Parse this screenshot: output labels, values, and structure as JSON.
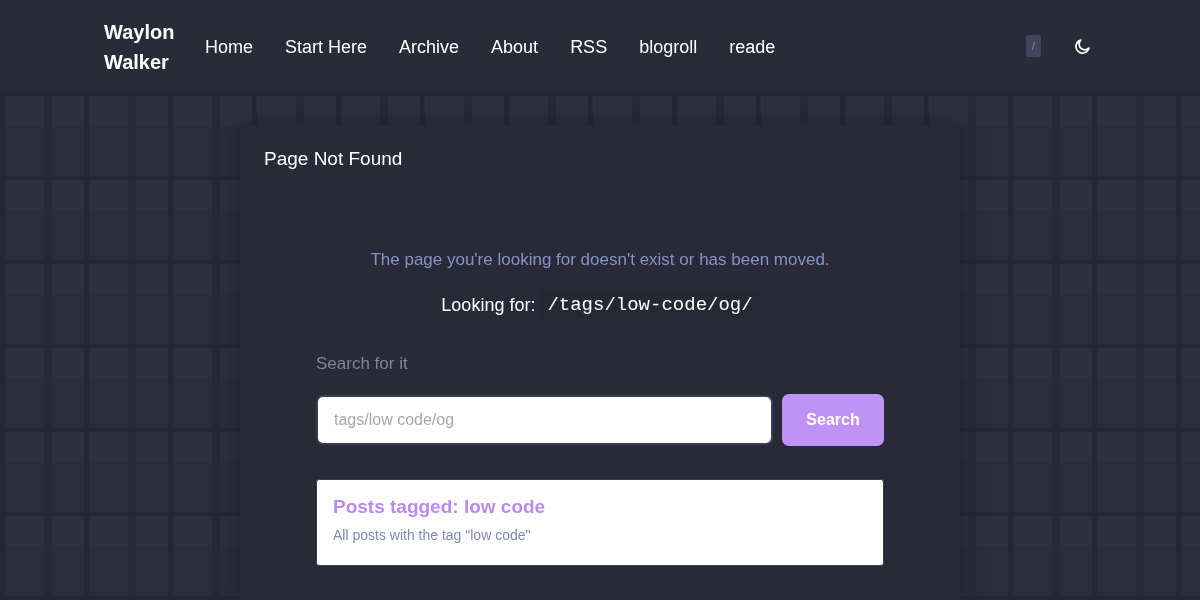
{
  "header": {
    "logo": "Waylon Walker",
    "nav": [
      "Home",
      "Start Here",
      "Archive",
      "About",
      "RSS",
      "blogroll",
      "reade"
    ],
    "shortcut_key": "/"
  },
  "card": {
    "title": "Page Not Found",
    "message": "The page you're looking for doesn't exist or has been moved.",
    "looking_for_label": "Looking for:",
    "path": "/tags/low-code/og/",
    "search_label": "Search for it",
    "search": {
      "placeholder": "tags/low code/og",
      "button": "Search"
    },
    "results": [
      {
        "title": "Posts tagged: low code",
        "description": "All posts with the tag \"low code\""
      }
    ]
  }
}
